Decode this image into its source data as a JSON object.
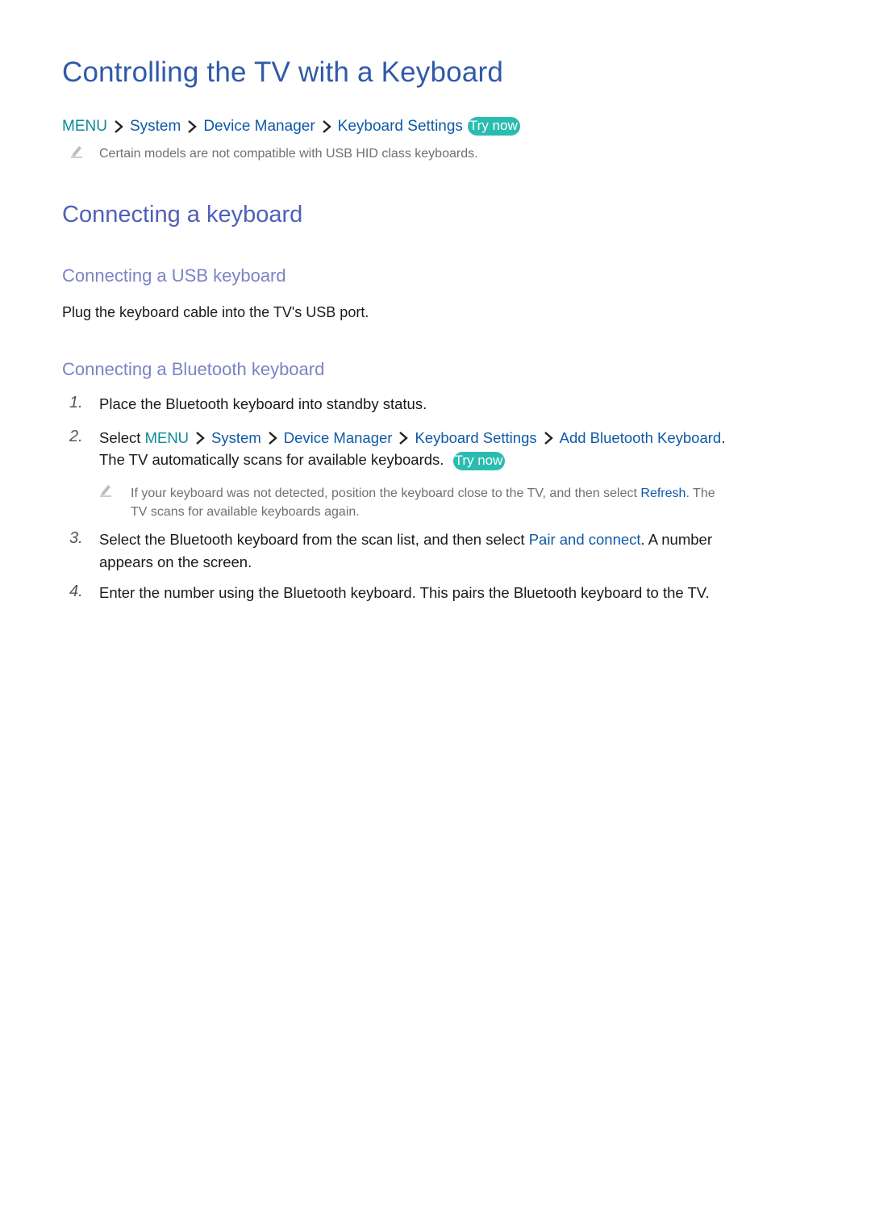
{
  "title": "Controlling the TV with a Keyboard",
  "breadcrumb": {
    "items": [
      "MENU",
      "System",
      "Device Manager",
      "Keyboard Settings"
    ],
    "try_now": "Try now"
  },
  "top_note": "Certain models are not compatible with USB HID class keyboards.",
  "section": {
    "heading": "Connecting a keyboard",
    "usb": {
      "heading": "Connecting a USB keyboard",
      "text": "Plug the keyboard cable into the TV's USB port."
    },
    "bluetooth": {
      "heading": "Connecting a Bluetooth keyboard",
      "steps": [
        {
          "number": "1.",
          "text": "Place the Bluetooth keyboard into standby status."
        },
        {
          "number": "2.",
          "prefix": "Select",
          "path": [
            "MENU",
            "System",
            "Device Manager",
            "Keyboard Settings",
            "Add Bluetooth Keyboard"
          ],
          "suffix": ".",
          "line2": "The TV automatically scans for available keyboards.",
          "try_now": "Try now",
          "note_part1": "If your keyboard was not detected, position the keyboard close to the TV, and then select",
          "note_link": "Refresh",
          "note_part2": ". The",
          "note_line2": "TV scans for available keyboards again."
        },
        {
          "number": "3.",
          "part1": "Select the Bluetooth keyboard from the scan list, and then select",
          "link": "Pair and connect",
          "part2": ". A number",
          "line2": "appears on the screen."
        },
        {
          "number": "4.",
          "text": "Enter the number using the Bluetooth keyboard. This pairs the Bluetooth keyboard to the TV."
        }
      ]
    }
  },
  "colors": {
    "title": "#2f5aa8",
    "menu": "#0e8a9a",
    "link": "#0f5aa6",
    "try_now_bg": "#2bbcb0",
    "h2": "#5060b6",
    "h3": "#7b83c6"
  }
}
